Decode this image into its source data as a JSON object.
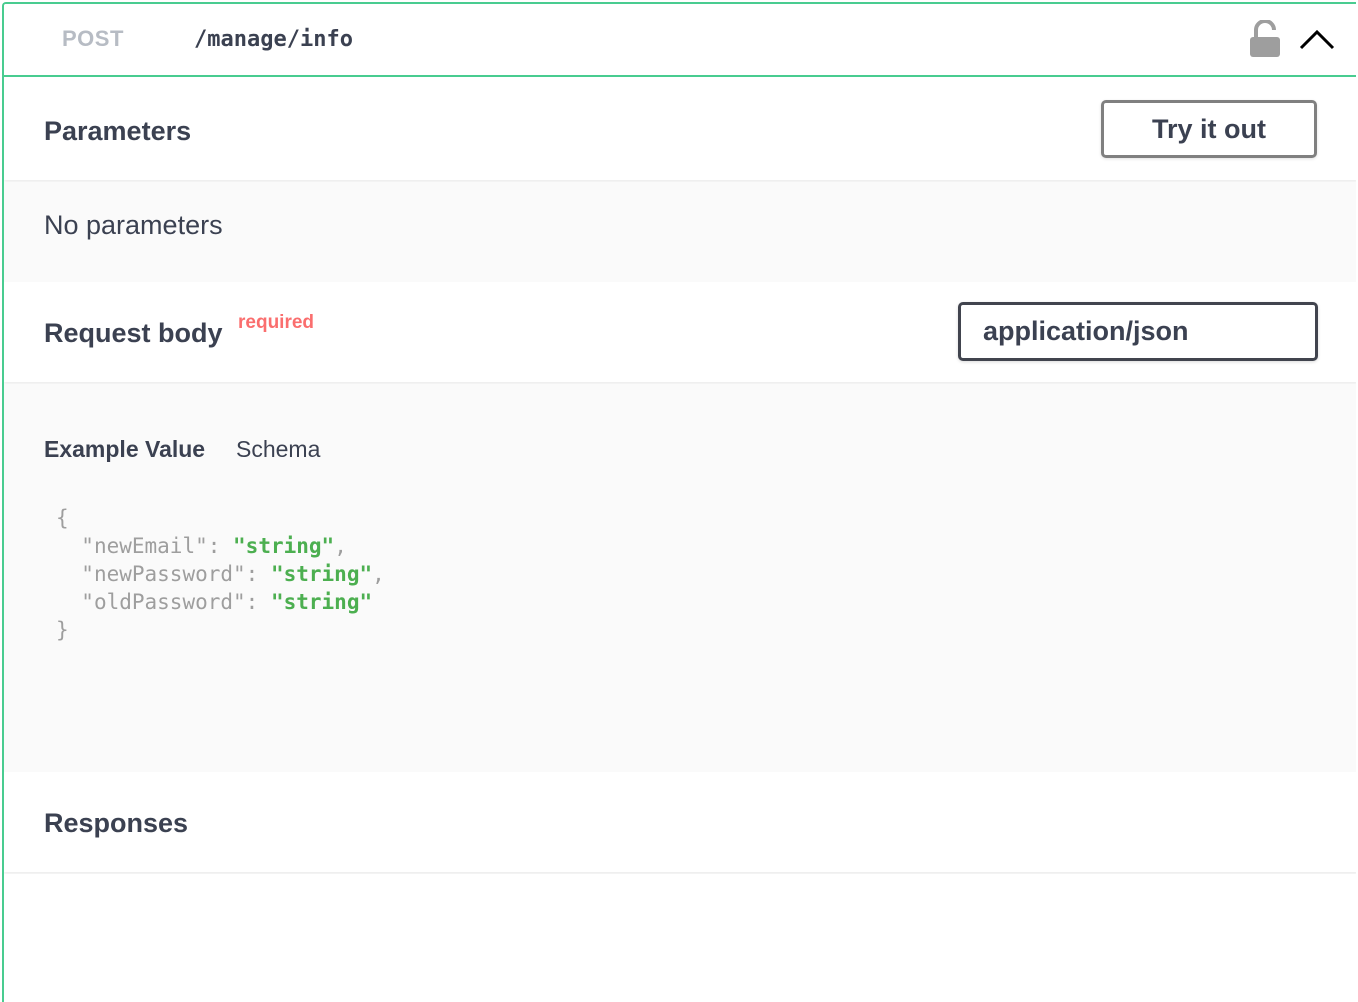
{
  "operation": {
    "method": "POST",
    "path": "/manage/info"
  },
  "parameters": {
    "title": "Parameters",
    "try_button": "Try it out",
    "empty_text": "No parameters"
  },
  "request_body": {
    "title": "Request body",
    "required_label": "required",
    "content_type": "application/json",
    "tabs": {
      "example": "Example Value",
      "schema": "Schema"
    },
    "example": {
      "open_brace": "{",
      "close_brace": "}",
      "fields": [
        {
          "key": "\"newEmail\"",
          "value": "\"string\"",
          "trail": ","
        },
        {
          "key": "\"newPassword\"",
          "value": "\"string\"",
          "trail": ","
        },
        {
          "key": "\"oldPassword\"",
          "value": "\"string\"",
          "trail": ""
        }
      ]
    }
  },
  "responses": {
    "title": "Responses"
  },
  "icons": {
    "lock": "lock-open-icon",
    "collapse": "chevron-up-icon"
  },
  "colors": {
    "post_accent": "#49cc90",
    "required": "#f93e3e",
    "string_value": "#4caf50"
  }
}
